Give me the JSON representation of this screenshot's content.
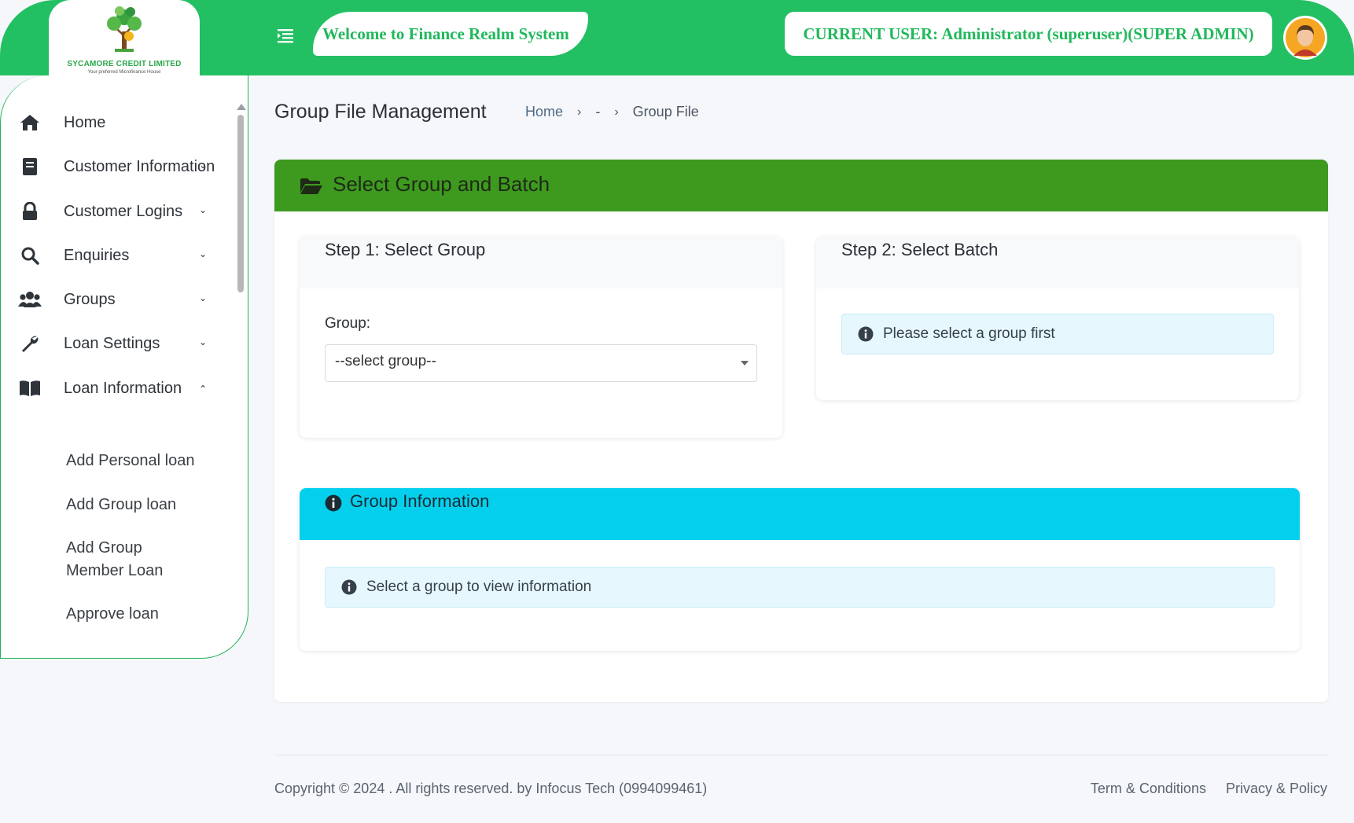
{
  "header": {
    "company_name": "SYCAMORE CREDIT LIMITED",
    "company_tagline": "Your preferred Microfinance House",
    "welcome": "Welcome to Finance Realm System",
    "current_user": "CURRENT USER: Administrator (superuser)(SUPER ADMIN)",
    "brand_color": "#22c063"
  },
  "sidebar": {
    "items": [
      {
        "label": "Home",
        "icon": "home-icon"
      },
      {
        "label": "Customer Information",
        "icon": "document-icon"
      },
      {
        "label": "Customer Logins",
        "icon": "lock-icon"
      },
      {
        "label": "Enquiries",
        "icon": "search-icon"
      },
      {
        "label": "Groups",
        "icon": "users-icon"
      },
      {
        "label": "Loan Settings",
        "icon": "wrench-icon"
      },
      {
        "label": "Loan Information",
        "icon": "book-icon"
      }
    ],
    "sub_items": [
      {
        "label": "Add Personal loan"
      },
      {
        "label": "Add Group loan"
      },
      {
        "label": "Add Group Member Loan"
      },
      {
        "label": "Approve loan"
      }
    ]
  },
  "page": {
    "title": "Group File Management",
    "breadcrumb": [
      "Home",
      "-",
      "Group File"
    ]
  },
  "panel": {
    "title": "Select Group and Batch",
    "header_color": "#3d9a1f"
  },
  "step1": {
    "title": "Step 1: Select Group",
    "label": "Group:",
    "selected": "--select group--"
  },
  "step2": {
    "title": "Step 2: Select Batch",
    "message": "Please select a group first"
  },
  "group_info": {
    "title": "Group Information",
    "message": "Select a group to view information",
    "header_color": "#04d0ee"
  },
  "footer": {
    "copyright": "Copyright © 2024 . All rights reserved. by Infocus Tech (0994099461)",
    "terms": "Term & Conditions",
    "privacy": "Privacy & Policy"
  }
}
